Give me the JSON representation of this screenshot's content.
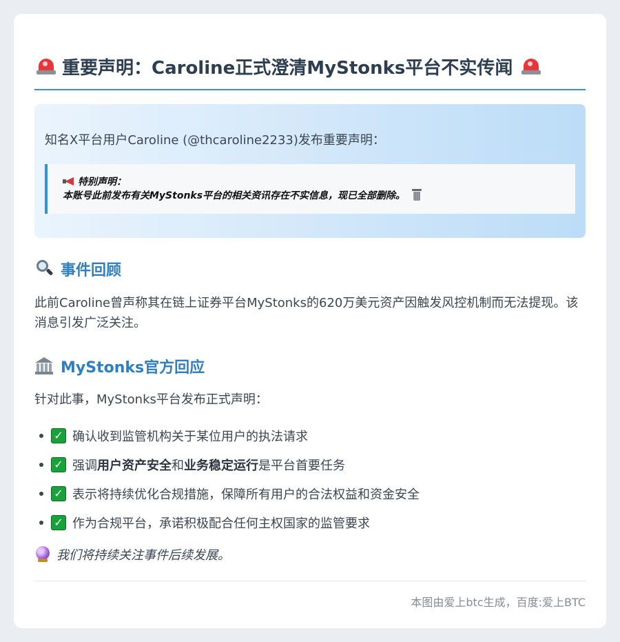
{
  "title": "重要声明：Caroline正式澄清MyStonks平台不实传闻",
  "intro": {
    "text": "知名X平台用户Caroline (@thcaroline2233)发布重要声明：",
    "notice_label": "特别声明：",
    "notice_text": "本账号此前发布有关MyStonks平台的相关资讯存在不实信息，现已全部删除。"
  },
  "review": {
    "heading": "事件回顾",
    "body": "此前Caroline曾声称其在链上证券平台MyStonks的620万美元资产因触发风控机制而无法提现。该消息引发广泛关注。"
  },
  "official": {
    "heading": "MyStonks官方回应",
    "lead": "针对此事，MyStonks平台发布正式声明：",
    "points": [
      {
        "text": "确认收到监管机构关于某位用户的执法请求"
      },
      {
        "pre": "强调",
        "bold1": "用户资产安全",
        "mid": "和",
        "bold2": "业务稳定运行",
        "post": "是平台首要任务"
      },
      {
        "text": "表示将持续优化合规措施，保障所有用户的合法权益和资金安全"
      },
      {
        "text": "作为合规平台，承诺积极配合任何主权国家的监管要求"
      }
    ]
  },
  "outlook": "我们将持续关注事件后续发展。",
  "footer": "本图由爱上btc生成，百度:爱上BTC",
  "icons": {
    "title": "police-light-icon",
    "notice": "megaphone-icon",
    "notice_end": "wastebasket-icon",
    "review": "magnifier-icon",
    "official": "bank-icon",
    "points": "check-mark-icon",
    "outlook": "crystal-ball-icon"
  },
  "colors": {
    "accent": "#2f7fc0",
    "rule": "#3a8fd0",
    "check": "#18a33a",
    "siren": "#e8363b"
  }
}
